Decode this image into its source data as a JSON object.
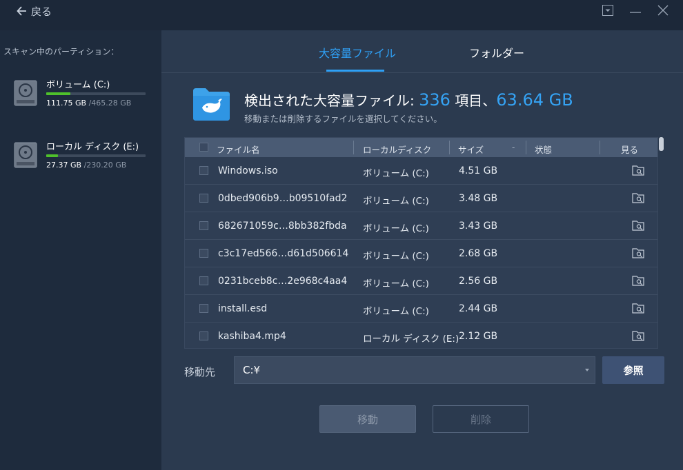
{
  "titlebar": {
    "back_label": "戻る"
  },
  "sidebar": {
    "title": "スキャン中のパーティション：",
    "partitions": [
      {
        "name": "ボリューム (C:)",
        "used": "111.75 GB",
        "total": "/465.28 GB",
        "used_fraction": 0.24
      },
      {
        "name": "ローカル ディスク (E:)",
        "used": "27.37 GB",
        "total": "/230.20 GB",
        "used_fraction": 0.12
      }
    ]
  },
  "tabs": [
    {
      "label": "大容量ファイル",
      "active": true
    },
    {
      "label": "フォルダー",
      "active": false
    }
  ],
  "summary": {
    "prefix": "検出された大容量ファイル: ",
    "count": "336",
    "count_unit": " 項目、",
    "size": "63.64 GB",
    "hint": "移動または削除するファイルを選択してください。"
  },
  "table": {
    "headers": {
      "name": "ファイル名",
      "location": "ローカルディスク",
      "size": "サイズ",
      "sort_indicator": "-",
      "status": "状態",
      "view": "見る"
    },
    "rows": [
      {
        "name": "Windows.iso",
        "location": "ボリューム (C:)",
        "size": "4.51 GB",
        "status": ""
      },
      {
        "name": "0dbed906b9…b09510fad2",
        "location": "ボリューム (C:)",
        "size": "3.48 GB",
        "status": ""
      },
      {
        "name": "682671059c…8bb382fbda",
        "location": "ボリューム (C:)",
        "size": "3.43 GB",
        "status": ""
      },
      {
        "name": "c3c17ed566…d61d506614",
        "location": "ボリューム (C:)",
        "size": "2.68 GB",
        "status": ""
      },
      {
        "name": "0231bceb8c…2e968c4aa4",
        "location": "ボリューム (C:)",
        "size": "2.56 GB",
        "status": ""
      },
      {
        "name": "install.esd",
        "location": "ボリューム (C:)",
        "size": "2.44 GB",
        "status": ""
      },
      {
        "name": "kashiba4.mp4",
        "location": "ローカル ディスク (E:)",
        "size": "2.12 GB",
        "status": ""
      }
    ]
  },
  "destination": {
    "label": "移動先",
    "value": "C:¥",
    "browse_label": "参照"
  },
  "actions": {
    "move_label": "移動",
    "delete_label": "削除"
  },
  "colors": {
    "accent": "#2fa0f5",
    "usage_bar": "#4fc12b",
    "background": "#2b3a4f",
    "sidebar": "#1e2b3d"
  },
  "icons": [
    "back-arrow-icon",
    "dropdown-menu-icon",
    "minimize-icon",
    "close-icon",
    "disk-drive-icon",
    "folder-whale-icon",
    "view-folder-icon"
  ]
}
